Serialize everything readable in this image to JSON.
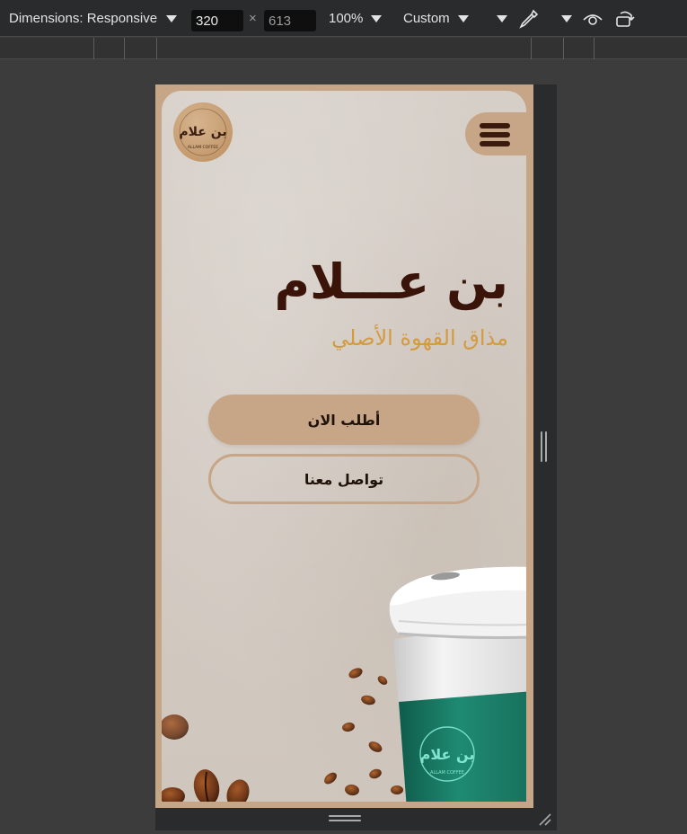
{
  "devtools": {
    "dimensions_label": "Dimensions: Responsive",
    "width_value": "320",
    "times_sign": "×",
    "height_value": "613",
    "zoom_label": "100%",
    "throttle_label": "Custom"
  },
  "site": {
    "logo_text": "بن علام",
    "logo_subtext": "ALLAM COFFEE",
    "title": "بن عـــلام",
    "subtitle": "مذاق القهوة الأصلي",
    "primary_button": "أطلب الان",
    "secondary_button": "تواصل معنا",
    "cup_logo_text": "بن علام",
    "cup_logo_subtext": "ALLAM COFFEE"
  },
  "colors": {
    "brand_tan": "#c7a687",
    "title_brown": "#3a1408",
    "subtitle_gold": "#d49a3e",
    "cup_green": "#1f8a72"
  }
}
